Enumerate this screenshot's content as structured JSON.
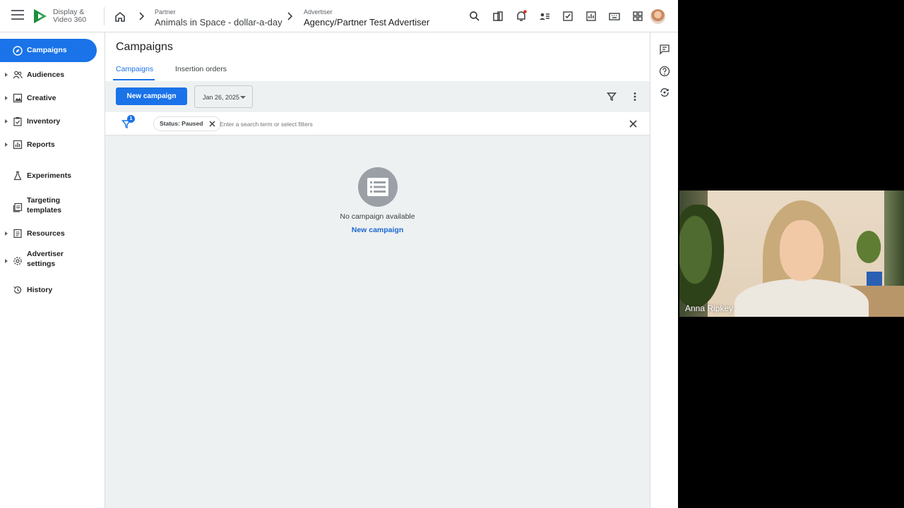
{
  "app": {
    "logo_text": "Display & Video 360"
  },
  "breadcrumb": {
    "partner_label": "Partner",
    "partner_value": "Animals in Space - dollar-a-day",
    "advertiser_label": "Advertiser",
    "advertiser_value": "Agency/Partner Test Advertiser"
  },
  "sidebar": {
    "items": [
      {
        "label": "Campaigns",
        "icon": "compass-icon",
        "active": true
      },
      {
        "label": "Audiences",
        "icon": "people-icon",
        "expandable": true
      },
      {
        "label": "Creative",
        "icon": "image-icon",
        "expandable": true
      },
      {
        "label": "Inventory",
        "icon": "clipboard-icon",
        "expandable": true
      },
      {
        "label": "Reports",
        "icon": "bar-chart-icon",
        "expandable": true
      },
      {
        "label": "Experiments",
        "icon": "flask-icon"
      },
      {
        "label": "Targeting\ntemplates",
        "icon": "template-icon"
      },
      {
        "label": "Resources",
        "icon": "document-icon",
        "expandable": true
      },
      {
        "label": "Advertiser\nsettings",
        "icon": "gear-icon",
        "expandable": true
      },
      {
        "label": "History",
        "icon": "history-icon"
      }
    ]
  },
  "main": {
    "title": "Campaigns",
    "tabs": [
      {
        "label": "Campaigns",
        "active": true
      },
      {
        "label": "Insertion orders",
        "active": false
      }
    ],
    "toolbar": {
      "new_campaign_label": "New campaign",
      "date_label": "Jan 26, 2025"
    },
    "filters": {
      "badge_count": "1",
      "chip_label": "Status: Paused",
      "search_placeholder": "Enter a search term or select filters"
    },
    "empty_state": {
      "message": "No campaign available",
      "link": "New campaign"
    }
  },
  "video": {
    "participant_name": "Anna Ripkey"
  },
  "colors": {
    "accent": "#1a73e8",
    "main_bg": "#eef1f1",
    "empty_icon_bg": "#9aa0a6"
  }
}
